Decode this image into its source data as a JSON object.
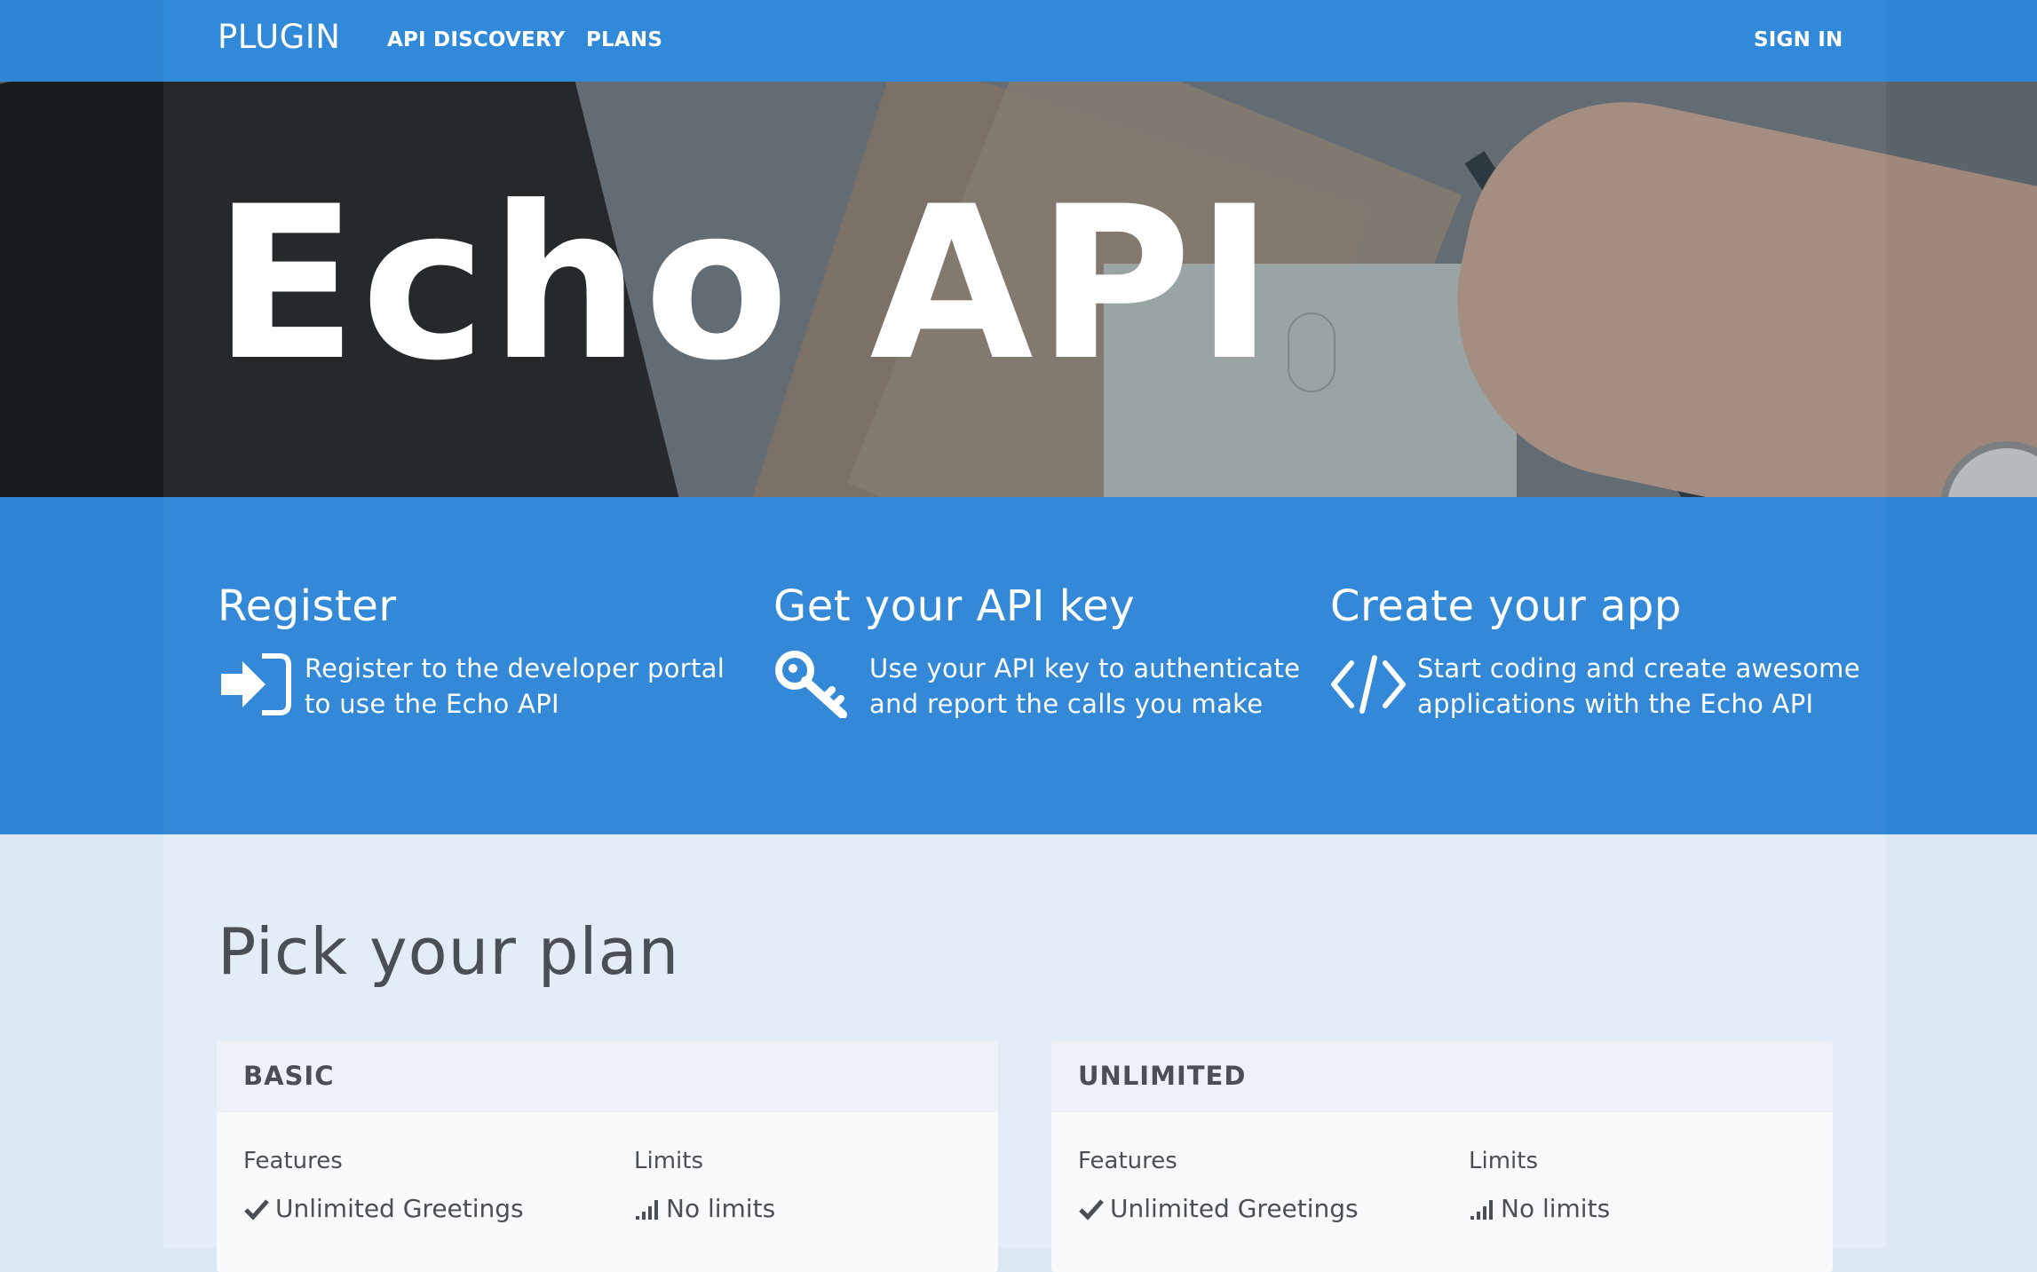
{
  "navbar": {
    "brand": "PLUGIN",
    "links": [
      {
        "label": "API DISCOVERY"
      },
      {
        "label": "PLANS"
      }
    ],
    "sign_in": "SIGN IN"
  },
  "hero": {
    "title": "Echo API"
  },
  "steps": [
    {
      "title": "Register",
      "text": "Register to the developer portal to use the Echo API",
      "icon": "sign-in-icon"
    },
    {
      "title": "Get your API key",
      "text": "Use your API key to authenticate and report the calls you make",
      "icon": "key-icon"
    },
    {
      "title": "Create your app",
      "text": "Start coding and create awesome applications with the Echo API",
      "icon": "code-icon"
    }
  ],
  "plans": {
    "title": "Pick your plan",
    "cards": [
      {
        "name": "BASIC",
        "features_label": "Features",
        "limits_label": "Limits",
        "features": [
          "Unlimited Greetings"
        ],
        "limits": [
          "No limits"
        ]
      },
      {
        "name": "UNLIMITED",
        "features_label": "Features",
        "limits_label": "Limits",
        "features": [
          "Unlimited Greetings"
        ],
        "limits": [
          "No limits"
        ]
      }
    ]
  },
  "colors": {
    "primary_blue": "#3189d9",
    "text_dark": "#4a4f55",
    "page_bg": "#dbe8f4"
  }
}
